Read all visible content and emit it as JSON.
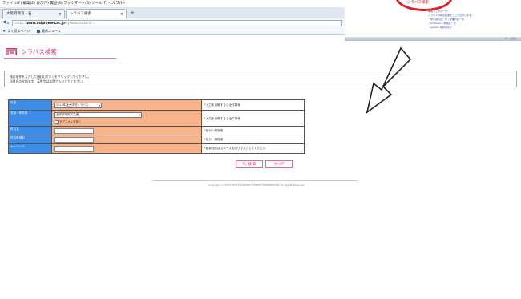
{
  "browser": {
    "menu": "ファイル(F)  編集(E)  表示(V)  履歴(S)  ブックマーク(B)  ツール(T)  ヘルプ(H)",
    "tabs": [
      {
        "label": "大阪府教育 - 名...",
        "active": false
      },
      {
        "label": "シラバス検索",
        "active": true
      }
    ],
    "url_host": "www.osipromet.ac.jp",
    "bookmarks": [
      {
        "label": "よく見るページ",
        "icon": "star-icon"
      },
      {
        "label": "最新ニュース",
        "icon": "rss-icon"
      }
    ]
  },
  "page": {
    "title": "シラバス検索",
    "notice_lines": [
      "検索条件を入力して[検索]ボタンをクリックしてください。",
      "科目名の全角文字、英数字は半角で入力してください。"
    ],
    "form": {
      "rows": [
        {
          "label": "年度",
          "value": "2013年度大学院シラバス",
          "note": "*入力を省略すると全件検索"
        },
        {
          "label": "学部・研究科",
          "value": "全学部研究科共通",
          "checkbox": "サブフォルダ含む",
          "note": "*入力を省略すると全件検索"
        },
        {
          "label": "科目名",
          "value": "",
          "note": "*部分一致検索"
        },
        {
          "label": "担当教員名",
          "value": "",
          "note": "*部分一致検索"
        },
        {
          "label": "キーワード",
          "value": "",
          "note": "*複数指定はスペース区切りで入力してください"
        }
      ]
    },
    "buttons": {
      "search": "検 索",
      "clear": "クリア"
    },
    "copyright": "Copyright (c) 2013 KYOTO GAKUEN SYSTEM CORPORATION. All Rights Reserved."
  },
  "overlay": {
    "red_text": "シラバス検索",
    "lines": [
      "情報ブックマーク",
      "シラバスの検索結果をここに表示します。",
      "・前年度科目一覧 / 授業計画一覧",
      "・Professor / 教員名一覧",
      "・system 時間割表示"
    ],
    "bar_text": "ページ表示"
  },
  "colors": {
    "label_bg": "#3d8ce6",
    "control_bg": "#f8b38a",
    "accent": "#d03a80",
    "highlight_ring": "#e0202a"
  }
}
